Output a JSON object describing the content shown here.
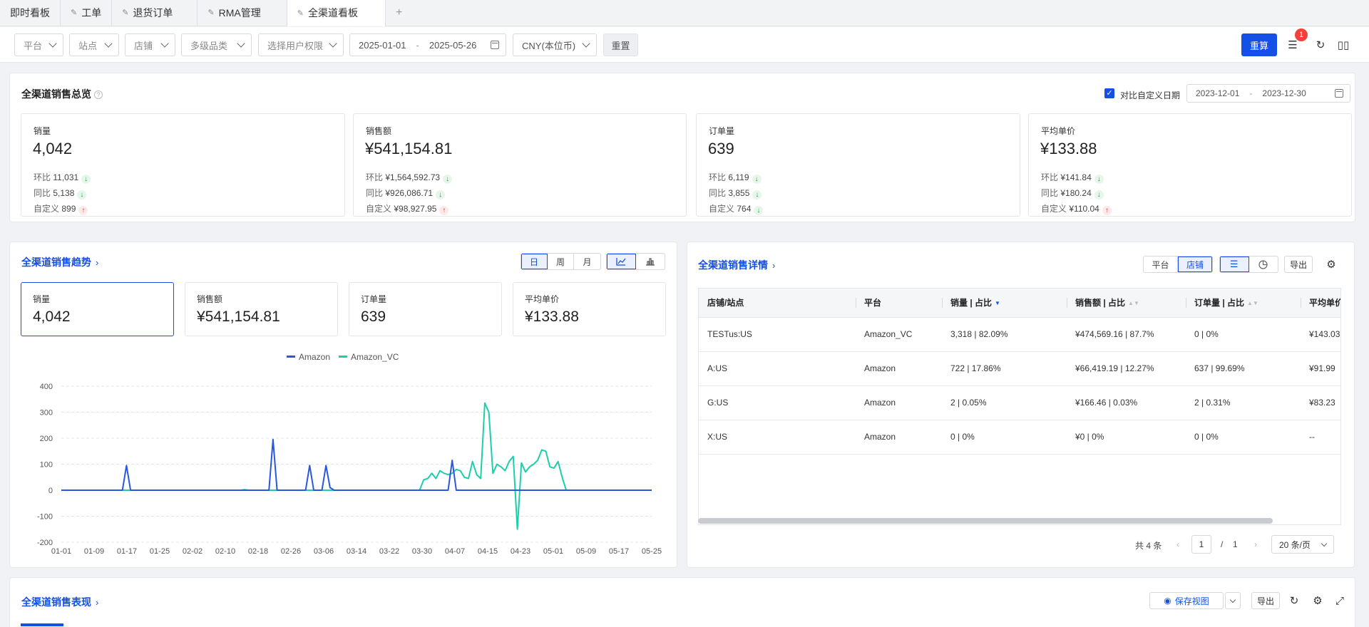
{
  "tabs": [
    {
      "label": "即时看板",
      "pinned": false
    },
    {
      "label": "工单",
      "pinned": true
    },
    {
      "label": "退货订单",
      "pinned": true
    },
    {
      "label": "RMA管理",
      "pinned": true
    },
    {
      "label": "全渠道看板",
      "pinned": true,
      "active": true
    }
  ],
  "filters": {
    "platform": "平台",
    "site": "站点",
    "store": "店铺",
    "category": "多级品类",
    "permission": "选择用户权限",
    "date_start": "2025-01-01",
    "date_sep": "-",
    "date_end": "2025-05-26",
    "currency": "CNY(本位币)",
    "reset": "重置",
    "recalc": "重算",
    "notice_count": "1"
  },
  "overview": {
    "title": "全渠道销售总览",
    "compare_label": "对比自定义日期",
    "compare_start": "2023-12-01",
    "compare_sep": "-",
    "compare_end": "2023-12-30",
    "cards": [
      {
        "label": "销量",
        "value": "4,042",
        "rows": [
          {
            "k": "环比",
            "v": "11,031",
            "dir": "down"
          },
          {
            "k": "同比",
            "v": "5,138",
            "dir": "down"
          },
          {
            "k": "自定义",
            "v": "899",
            "dir": "up"
          }
        ]
      },
      {
        "label": "销售额",
        "value": "¥541,154.81",
        "rows": [
          {
            "k": "环比",
            "v": "¥1,564,592.73",
            "dir": "down"
          },
          {
            "k": "同比",
            "v": "¥926,086.71",
            "dir": "down"
          },
          {
            "k": "自定义",
            "v": "¥98,927.95",
            "dir": "up"
          }
        ]
      },
      {
        "label": "订单量",
        "value": "639",
        "rows": [
          {
            "k": "环比",
            "v": "6,119",
            "dir": "down"
          },
          {
            "k": "同比",
            "v": "3,855",
            "dir": "down"
          },
          {
            "k": "自定义",
            "v": "764",
            "dir": "down"
          }
        ]
      },
      {
        "label": "平均单价",
        "value": "¥133.88",
        "rows": [
          {
            "k": "环比",
            "v": "¥141.84",
            "dir": "down"
          },
          {
            "k": "同比",
            "v": "¥180.24",
            "dir": "down"
          },
          {
            "k": "自定义",
            "v": "¥110.04",
            "dir": "up"
          }
        ]
      }
    ]
  },
  "trend": {
    "title": "全渠道销售趋势",
    "arrow": "›",
    "period": [
      "日",
      "周",
      "月"
    ],
    "active_period": "日",
    "kpis": [
      {
        "label": "销量",
        "value": "4,042"
      },
      {
        "label": "销售额",
        "value": "¥541,154.81"
      },
      {
        "label": "订单量",
        "value": "639"
      },
      {
        "label": "平均单价",
        "value": "¥133.88"
      }
    ]
  },
  "chart_data": {
    "type": "line",
    "x": [
      "01-01",
      "01-09",
      "01-17",
      "01-25",
      "02-02",
      "02-10",
      "02-18",
      "02-26",
      "03-06",
      "03-14",
      "03-22",
      "03-30",
      "04-07",
      "04-15",
      "04-23",
      "05-01",
      "05-09",
      "05-17",
      "05-25"
    ],
    "ylim": [
      -200,
      400
    ],
    "yticks": [
      400,
      300,
      200,
      100,
      0,
      -100,
      -200
    ],
    "grid": true,
    "legend": "top-center",
    "series": [
      {
        "name": "Amazon",
        "color": "#2a56e0",
        "points": [
          [
            0,
            0
          ],
          [
            15,
            0
          ],
          [
            16,
            95
          ],
          [
            17,
            0
          ],
          [
            44,
            0
          ],
          [
            45,
            0
          ],
          [
            51,
            0
          ],
          [
            52,
            195
          ],
          [
            53,
            0
          ],
          [
            60,
            0
          ],
          [
            61,
            95
          ],
          [
            62,
            0
          ],
          [
            64,
            0
          ],
          [
            65,
            95
          ],
          [
            66,
            10
          ],
          [
            67,
            0
          ],
          [
            95,
            0
          ],
          [
            96,
            115
          ],
          [
            97,
            0
          ],
          [
            140,
            0
          ],
          [
            145,
            0
          ]
        ]
      },
      {
        "name": "Amazon_VC",
        "color": "#1ccfa8",
        "points": [
          [
            0,
            0
          ],
          [
            44,
            0
          ],
          [
            45,
            2
          ],
          [
            46,
            0
          ],
          [
            88,
            0
          ],
          [
            89,
            40
          ],
          [
            90,
            45
          ],
          [
            91,
            65
          ],
          [
            92,
            45
          ],
          [
            93,
            75
          ],
          [
            94,
            65
          ],
          [
            95,
            60
          ],
          [
            96,
            65
          ],
          [
            97,
            80
          ],
          [
            98,
            75
          ],
          [
            99,
            50
          ],
          [
            100,
            45
          ],
          [
            101,
            110
          ],
          [
            102,
            60
          ],
          [
            103,
            45
          ],
          [
            104,
            335
          ],
          [
            105,
            300
          ],
          [
            106,
            65
          ],
          [
            107,
            100
          ],
          [
            108,
            90
          ],
          [
            109,
            75
          ],
          [
            110,
            110
          ],
          [
            111,
            130
          ],
          [
            112,
            -150
          ],
          [
            113,
            105
          ],
          [
            114,
            70
          ],
          [
            115,
            90
          ],
          [
            116,
            100
          ],
          [
            117,
            115
          ],
          [
            118,
            155
          ],
          [
            119,
            150
          ],
          [
            120,
            90
          ],
          [
            121,
            85
          ],
          [
            122,
            110
          ],
          [
            123,
            50
          ],
          [
            124,
            0
          ],
          [
            145,
            0
          ]
        ]
      }
    ]
  },
  "detail": {
    "title": "全渠道销售详情",
    "arrow": "›",
    "dim_tabs": [
      "平台",
      "店铺"
    ],
    "active_dim": "店铺",
    "export": "导出",
    "columns": [
      "店铺/站点",
      "平台",
      "销量 | 占比",
      "销售额 | 占比",
      "订单量 | 占比",
      "平均单价"
    ],
    "rows": [
      {
        "store": "TESTus:US",
        "platform": "Amazon_VC",
        "qty": "3,318  |  82.09%",
        "sales": "¥474,569.16  |  87.7%",
        "orders": "0  |  0%",
        "avg": "¥143.03"
      },
      {
        "store": "A:US",
        "platform": "Amazon",
        "qty": "722  |  17.86%",
        "sales": "¥66,419.19  |  12.27%",
        "orders": "637  |  99.69%",
        "avg": "¥91.99"
      },
      {
        "store": "G:US",
        "platform": "Amazon",
        "qty": "2  |  0.05%",
        "sales": "¥166.46  |  0.03%",
        "orders": "2  |  0.31%",
        "avg": "¥83.23"
      },
      {
        "store": "X:US",
        "platform": "Amazon",
        "qty": "0  |  0%",
        "sales": "¥0  |  0%",
        "orders": "0  |  0%",
        "avg": "--"
      }
    ],
    "total": "共 4 条",
    "page": "1",
    "page_sep": "/",
    "pages": "1",
    "page_size": "20 条/页"
  },
  "performance": {
    "title": "全渠道销售表现",
    "arrow": "›",
    "save_view": "保存视图",
    "export": "导出"
  }
}
